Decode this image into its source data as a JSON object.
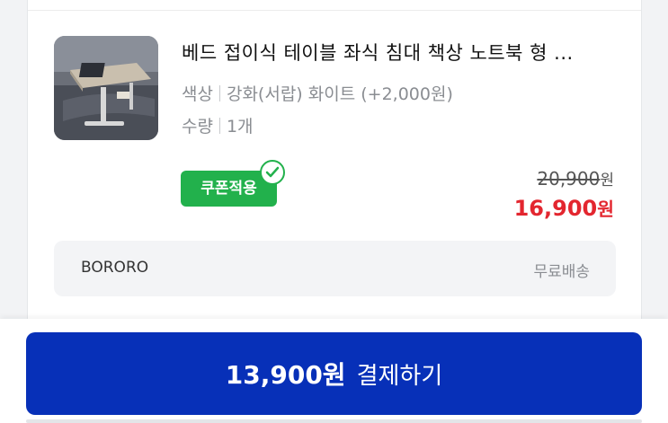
{
  "product": {
    "title": "베드 접이식 테이블 좌식 침대 책상 노트북 형 ...",
    "thumbnail_icon": "folding-desk-photo",
    "options": [
      {
        "label": "색상",
        "value": "강화(서랍) 화이트 (+2,000원)"
      },
      {
        "label": "수량",
        "value": "1개"
      }
    ],
    "coupon_badge": "쿠폰적용",
    "original_price": "20,900",
    "sale_price": "16,900",
    "currency_unit": "원"
  },
  "seller": {
    "name": "BORORO",
    "shipping": "무료배송"
  },
  "checkout": {
    "amount": "13,900원",
    "label": "결제하기"
  },
  "colors": {
    "pay_button": "#0730b8",
    "coupon_green": "#22b14c",
    "sale_red": "#e3262f"
  }
}
